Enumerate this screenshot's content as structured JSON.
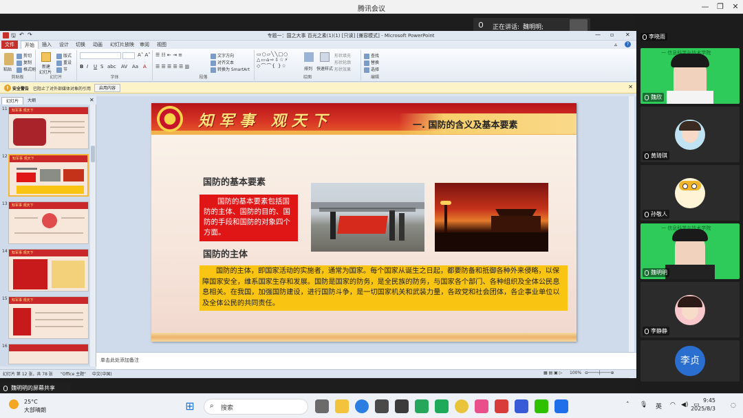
{
  "window": {
    "title": "腾讯会议"
  },
  "speaking": {
    "prefix": "正在讲话:",
    "name": "魏明明;"
  },
  "ppt": {
    "title": "专题一：国之大事 百光之素(1)(1) [只读] [兼容模式] - Microsoft PowerPoint",
    "tabs": [
      "文件",
      "开始",
      "插入",
      "设计",
      "切换",
      "动画",
      "幻灯片放映",
      "审阅",
      "视图"
    ],
    "groups": {
      "clipboard": {
        "label": "剪贴板",
        "paste": "粘贴",
        "cut": "剪切",
        "copy": "复制",
        "format": "格式刷"
      },
      "slides": {
        "label": "幻灯片",
        "new": "新建",
        "new2": "幻灯片",
        "layout": "版式",
        "reset": "重设",
        "section": "节"
      },
      "font": {
        "label": "字体"
      },
      "paragraph": {
        "label": "段落",
        "dir": "文字方向",
        "align": "对齐文本",
        "smartart": "转换为 SmartArt"
      },
      "drawing": {
        "label": "绘图",
        "arrange": "排列",
        "styles": "快速样式",
        "fill": "形状填充",
        "outline": "形状轮廓",
        "effect": "形状效果"
      },
      "editing": {
        "label": "编辑",
        "find": "查找",
        "replace": "替换",
        "select": "选择"
      }
    },
    "security": {
      "label": "安全警告",
      "message": "已阻止了对外部媒体对象的引用",
      "button": "启用内容"
    },
    "pane_tabs": [
      "幻灯片",
      "大纲"
    ],
    "thumbnails": [
      {
        "num": "11",
        "label": "知军事 观天下"
      },
      {
        "num": "12",
        "label": "知军事 观天下"
      },
      {
        "num": "13",
        "label": "知军事 观天下"
      },
      {
        "num": "14",
        "label": "知军事 观天下"
      },
      {
        "num": "15",
        "label": "知军事 观天下"
      },
      {
        "num": "16",
        "label": ""
      }
    ],
    "notes_placeholder": "单击此处添加备注",
    "status": {
      "slide": "幻灯片 第 12 张，共 78 张",
      "theme": "\"Office 主题\"",
      "lang": "中文(中国)",
      "zoom": "100%"
    }
  },
  "slide": {
    "slogan": "知军事 观天下",
    "section_title": "一. 国防的含义及基本要素",
    "heading1": "国防的基本要素",
    "red_text": "国防的基本要素包括国防的主体、国防的目的、国防的手段和国防的对象四个方面。",
    "heading2": "国防的主体",
    "body_text": "国防的主体，即国家活动的实施者，通常为国家。每个国家从诞生之日起，都要防备和抵御各种外来侵略，以保障国家安全，维系国家生存和发展。国防是国家的防务，是全民族的防务，与国家各个部门、各种组织及全体公民息息相关。在我国，加强国防建设，进行国防斗争，是一切国家机关和武装力量，各政党和社会团体，各企事业单位以及全体公民的共同责任。"
  },
  "participants": [
    {
      "name": "李晓雨",
      "type": "label"
    },
    {
      "name": "魏欣",
      "type": "video",
      "banner": "一 信息科学与技术学院"
    },
    {
      "name": "黄琦琪",
      "type": "avatar"
    },
    {
      "name": "孙敬人",
      "type": "avatar"
    },
    {
      "name": "魏明明",
      "type": "video",
      "banner": "一 信息科学与技术学院"
    },
    {
      "name": "李静静",
      "type": "avatar"
    },
    {
      "name": "李贞",
      "type": "initial"
    }
  ],
  "share": {
    "label": "魏明明的屏幕共享"
  },
  "taskbar": {
    "temp": "25°C",
    "weather": "大部晴朗",
    "search": "搜索",
    "ime": "英",
    "time": "9:45",
    "date": "2025/8/3"
  }
}
